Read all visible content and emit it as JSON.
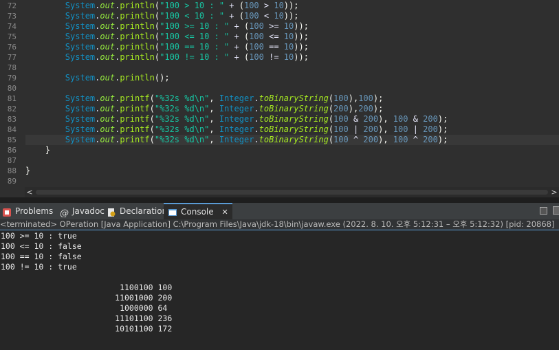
{
  "editor": {
    "line_numbers": [
      "72",
      "73",
      "74",
      "75",
      "76",
      "77",
      "78",
      "79",
      "80",
      "81",
      "82",
      "83",
      "84",
      "85",
      "86",
      "87",
      "88",
      "89"
    ],
    "tokens": {
      "system": "System",
      "out": "out",
      "println": "println",
      "printf": "printf",
      "integer": "Integer",
      "to_binary": "toBinaryString",
      "dot": ".",
      "lparen": "(",
      "rparen": ")",
      "lparen2": "((",
      "close_stmt": "));",
      "close_empty": "();",
      "plus": " + ",
      "comma": ", ",
      "semi": ";",
      "s72": "\"100 > 10 : \"",
      "s73": "\"100 < 10 : \"",
      "s74": "\"100 >= 10 : \"",
      "s75": "\"100 <= 10 : \"",
      "s76": "\"100 == 10 : \"",
      "s77": "\"100 != 10 : \"",
      "fmt": "\"%32s %d\\n\"",
      "n100": "100",
      "n10": "10",
      "n200": "200",
      "op_gt": " > ",
      "op_lt": " < ",
      "op_ge": " >= ",
      "op_le": " <= ",
      "op_eq": " == ",
      "op_ne": " != ",
      "op_and": " & ",
      "op_or": " | ",
      "op_xor": " ^ ",
      "close1": "),",
      "close2": "), ",
      "brace": "}"
    }
  },
  "tabs": [
    {
      "label": "Problems",
      "icon": "problems-icon"
    },
    {
      "label": "Javadoc",
      "icon": "javadoc-icon"
    },
    {
      "label": "Declaration",
      "icon": "declaration-icon"
    },
    {
      "label": "Console",
      "icon": "console-icon",
      "close": "✕"
    }
  ],
  "status_text": "<terminated> OPeration [Java Application] C:\\Program Files\\Java\\jdk-18\\bin\\javaw.exe  (2022. 8. 10. 오후 5:12:31 – 오후 5:12:32) [pid: 20868]",
  "console": {
    "lines": [
      "100 >= 10 : true",
      "100 <= 10 : false",
      "100 == 10 : false",
      "100 != 10 : true",
      "",
      "                         1100100 100",
      "                        11001000 200",
      "                         1000000 64",
      "                        11101100 236",
      "                        10101100 172"
    ]
  },
  "icons": {
    "scroll_left": "<",
    "scroll_right": ">"
  },
  "colors": {
    "accent": "#5a9bd5",
    "background": "#2f2f2f",
    "console_bg": "#262626"
  }
}
